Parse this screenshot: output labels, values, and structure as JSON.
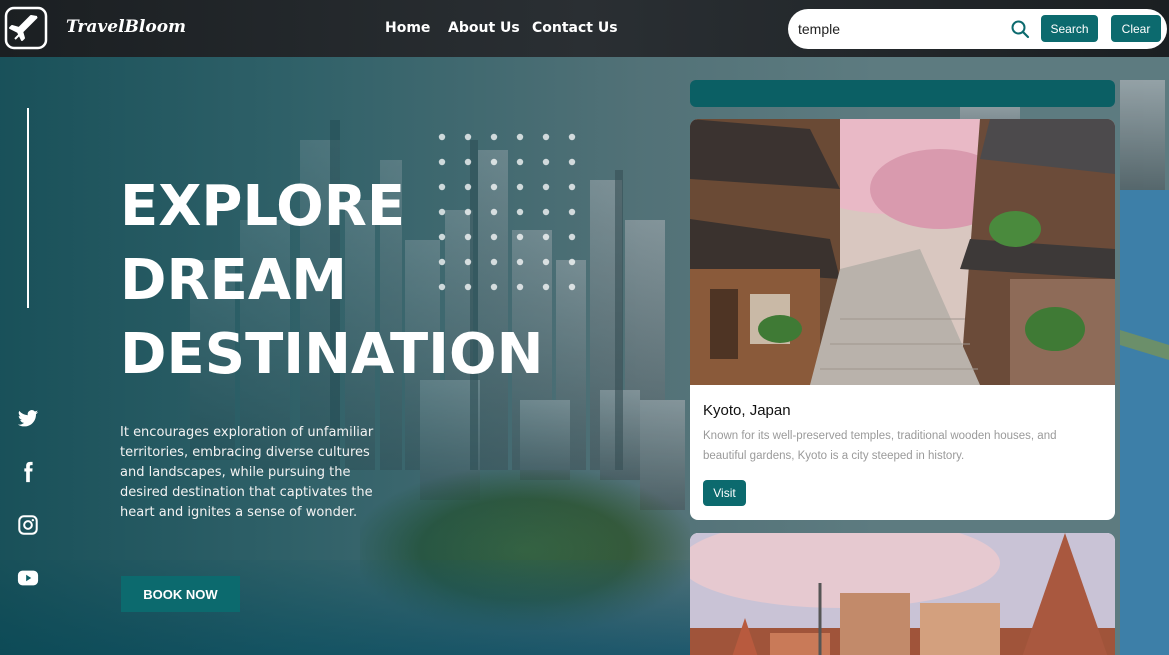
{
  "brand": {
    "name": "TravelBloom"
  },
  "nav": {
    "home": "Home",
    "about": "About Us",
    "contact": "Contact Us"
  },
  "search": {
    "value": "temple",
    "search_label": "Search",
    "clear_label": "Clear"
  },
  "hero": {
    "title_lines": [
      "EXPLORE",
      "DREAM",
      "DESTINATION"
    ],
    "description": "It encourages exploration of unfamiliar territories, embracing diverse cultures and landscapes, while pursuing the desired destination that captivates the heart and ignites a sense of wonder.",
    "book_now": "BOOK NOW"
  },
  "results": [
    {
      "title": "Kyoto, Japan",
      "description": "Known for its well-preserved temples, traditional wooden houses, and beautiful gardens, Kyoto is a city steeped in history.",
      "visit_label": "Visit"
    }
  ],
  "colors": {
    "teal": "#0c6a6e",
    "nav_bg": "#1b1f22"
  },
  "icons": [
    "airplane-icon",
    "search-icon",
    "twitter-icon",
    "facebook-icon",
    "instagram-icon",
    "youtube-icon"
  ]
}
